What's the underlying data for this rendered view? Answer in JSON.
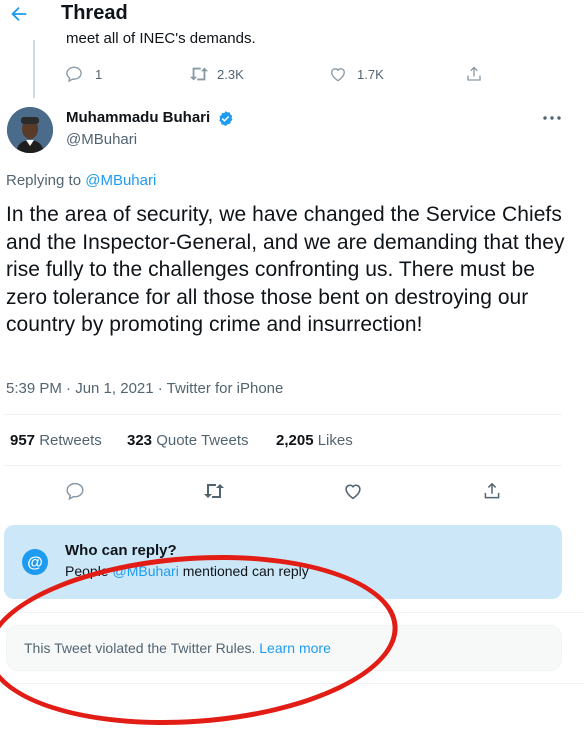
{
  "header": {
    "title": "Thread"
  },
  "previous_tweet": {
    "text": "meet all of INEC's demands.",
    "replies": "1",
    "retweets": "2.3K",
    "likes": "1.7K"
  },
  "author": {
    "name": "Muhammadu Buhari",
    "handle": "@MBuhari",
    "verified": true
  },
  "tweet": {
    "replying_prefix": "Replying to",
    "replying_to": "@MBuhari",
    "text": "In the area of security, we have changed the Service Chiefs and the Inspector-General, and we are demanding that they rise fully to the challenges confronting us. There must be zero tolerance for all those those bent on destroying our country by promoting crime and insurrection!",
    "timestamp": "5:39 PM · Jun 1, 2021 · Twitter for iPhone"
  },
  "stats": {
    "retweets_num": "957",
    "retweets_label": "Retweets",
    "quotes_num": "323",
    "quotes_label": "Quote Tweets",
    "likes_num": "2,205",
    "likes_label": "Likes"
  },
  "who_can_reply": {
    "title": "Who can reply?",
    "desc_prefix": "People",
    "mention": "@MBuhari",
    "desc_suffix": "mentioned can reply"
  },
  "violation": {
    "text": "This Tweet violated the Twitter Rules.",
    "link": "Learn more"
  },
  "colors": {
    "accent": "#1d9bf0",
    "annotation": "#e11d15",
    "reply_box_bg": "#cce7f8"
  }
}
